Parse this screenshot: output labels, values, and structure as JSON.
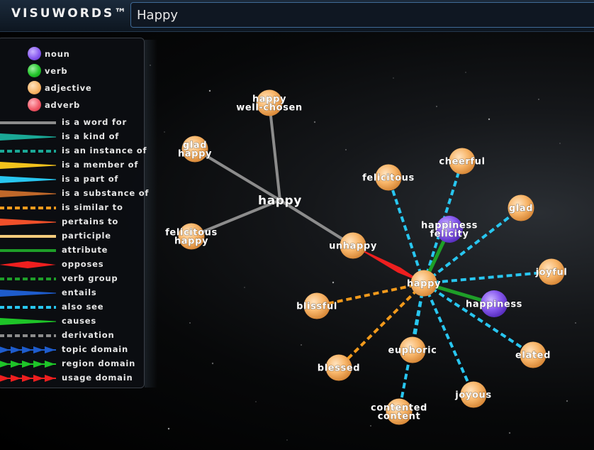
{
  "header": {
    "logo": "VISUWORDS™",
    "search_value": "Happy"
  },
  "legend": {
    "parts_of_speech": [
      {
        "label": "noun",
        "color": "#8a5cf0"
      },
      {
        "label": "verb",
        "color": "#22c42a"
      },
      {
        "label": "adjective",
        "color": "#f8b66a"
      },
      {
        "label": "adverb",
        "color": "#f25b6a"
      }
    ],
    "relations": [
      {
        "label": "is a word for",
        "color": "#8c8c8c",
        "style": "solid"
      },
      {
        "label": "is a kind of",
        "color": "#1aa896",
        "style": "wedge"
      },
      {
        "label": "is an instance of",
        "color": "#1aa896",
        "style": "dash"
      },
      {
        "label": "is a member of",
        "color": "#f2c21c",
        "style": "wedge"
      },
      {
        "label": "is a part of",
        "color": "#28c6f0",
        "style": "wedge"
      },
      {
        "label": "is a substance of",
        "color": "#c0682a",
        "style": "wedge"
      },
      {
        "label": "is similar to",
        "color": "#f29a1c",
        "style": "dash"
      },
      {
        "label": "pertains to",
        "color": "#f0502a",
        "style": "wedge"
      },
      {
        "label": "participle",
        "color": "#f5cc7c",
        "style": "solid"
      },
      {
        "label": "attribute",
        "color": "#1e9e28",
        "style": "solid"
      },
      {
        "label": "opposes",
        "color": "#ee1f1f",
        "style": "diamond"
      },
      {
        "label": "verb group",
        "color": "#1e9e28",
        "style": "dash"
      },
      {
        "label": "entails",
        "color": "#1e5ccc",
        "style": "wedge"
      },
      {
        "label": "also see",
        "color": "#28c6f0",
        "style": "dash"
      },
      {
        "label": "causes",
        "color": "#1ec428",
        "style": "wedge"
      },
      {
        "label": "derivation",
        "color": "#8c8c8c",
        "style": "dash"
      },
      {
        "label": "topic domain",
        "color": "#1e5ccc",
        "style": "arrows"
      },
      {
        "label": "region domain",
        "color": "#1ec428",
        "style": "arrows"
      },
      {
        "label": "usage domain",
        "color": "#ee1f1f",
        "style": "arrows"
      }
    ]
  },
  "graph": {
    "colors": {
      "adjective": "#f8b66a",
      "noun": "#8a5cf0",
      "word_for": "#8c8c8c",
      "also_see": "#28c6f0",
      "similar": "#f29a1c",
      "attribute": "#1e9e28",
      "opposes": "#ee1f1f"
    },
    "nodes": [
      {
        "id": "hub",
        "label": [
          "happy"
        ],
        "type": "word"
      },
      {
        "id": "hw",
        "label": [
          "happy",
          "well-chosen"
        ],
        "type": "adjective"
      },
      {
        "id": "gh",
        "label": [
          "glad",
          "happy"
        ],
        "type": "adjective"
      },
      {
        "id": "fh",
        "label": [
          "felicitous",
          "happy"
        ],
        "type": "adjective"
      },
      {
        "id": "un",
        "label": [
          "unhappy"
        ],
        "type": "adjective"
      },
      {
        "id": "ha",
        "label": [
          "happy"
        ],
        "type": "adjective"
      },
      {
        "id": "fe",
        "label": [
          "felicitous"
        ],
        "type": "adjective"
      },
      {
        "id": "ch",
        "label": [
          "cheerful"
        ],
        "type": "adjective"
      },
      {
        "id": "hf",
        "label": [
          "happiness",
          "felicity"
        ],
        "type": "noun"
      },
      {
        "id": "gl",
        "label": [
          "glad"
        ],
        "type": "adjective"
      },
      {
        "id": "jo",
        "label": [
          "joyful"
        ],
        "type": "adjective"
      },
      {
        "id": "hp",
        "label": [
          "happiness"
        ],
        "type": "noun"
      },
      {
        "id": "el",
        "label": [
          "elated"
        ],
        "type": "adjective"
      },
      {
        "id": "jy",
        "label": [
          "joyous"
        ],
        "type": "adjective"
      },
      {
        "id": "cc",
        "label": [
          "contented",
          "content"
        ],
        "type": "adjective"
      },
      {
        "id": "eu",
        "label": [
          "euphoric"
        ],
        "type": "adjective"
      },
      {
        "id": "bd",
        "label": [
          "blessed"
        ],
        "type": "adjective"
      },
      {
        "id": "bf",
        "label": [
          "blissful"
        ],
        "type": "adjective"
      }
    ],
    "edges": [
      {
        "from": "hub",
        "to": "hw",
        "rel": "word_for"
      },
      {
        "from": "hub",
        "to": "gh",
        "rel": "word_for"
      },
      {
        "from": "hub",
        "to": "fh",
        "rel": "word_for"
      },
      {
        "from": "hub",
        "to": "un",
        "rel": "word_for"
      },
      {
        "from": "ha",
        "to": "un",
        "rel": "opposes"
      },
      {
        "from": "ha",
        "to": "fe",
        "rel": "also_see"
      },
      {
        "from": "ha",
        "to": "ch",
        "rel": "also_see"
      },
      {
        "from": "ha",
        "to": "gl",
        "rel": "also_see"
      },
      {
        "from": "ha",
        "to": "jo",
        "rel": "also_see"
      },
      {
        "from": "ha",
        "to": "el",
        "rel": "also_see"
      },
      {
        "from": "ha",
        "to": "jy",
        "rel": "also_see"
      },
      {
        "from": "ha",
        "to": "cc",
        "rel": "also_see"
      },
      {
        "from": "ha",
        "to": "eu",
        "rel": "also_see"
      },
      {
        "from": "ha",
        "to": "hf",
        "rel": "attribute"
      },
      {
        "from": "ha",
        "to": "hp",
        "rel": "attribute"
      },
      {
        "from": "ha",
        "to": "bd",
        "rel": "similar"
      },
      {
        "from": "ha",
        "to": "bf",
        "rel": "similar"
      }
    ]
  }
}
